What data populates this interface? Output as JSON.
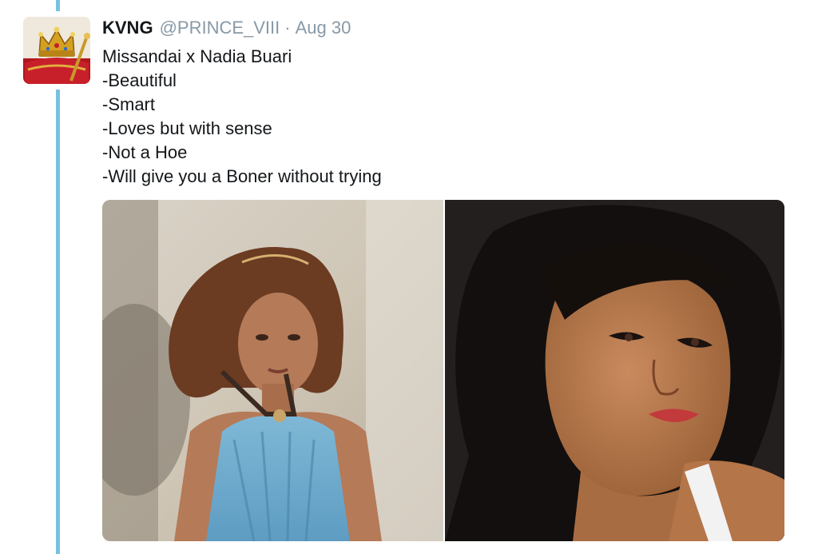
{
  "tweet": {
    "display_name": "KVNG",
    "handle": "@PRINCE_VIII",
    "separator": "·",
    "timestamp": "Aug 30",
    "text_lines": [
      "Missandai x Nadia Buari",
      "-Beautiful",
      "-Smart",
      "-Loves but with sense",
      "-Not a Hoe",
      "-Will give you a Boner without trying"
    ]
  },
  "colors": {
    "thread_line": "#78c1e0",
    "meta_gray": "#8899a6",
    "text": "#14171a"
  },
  "icons": {
    "avatar": "crown-on-red-cushion-avatar"
  }
}
